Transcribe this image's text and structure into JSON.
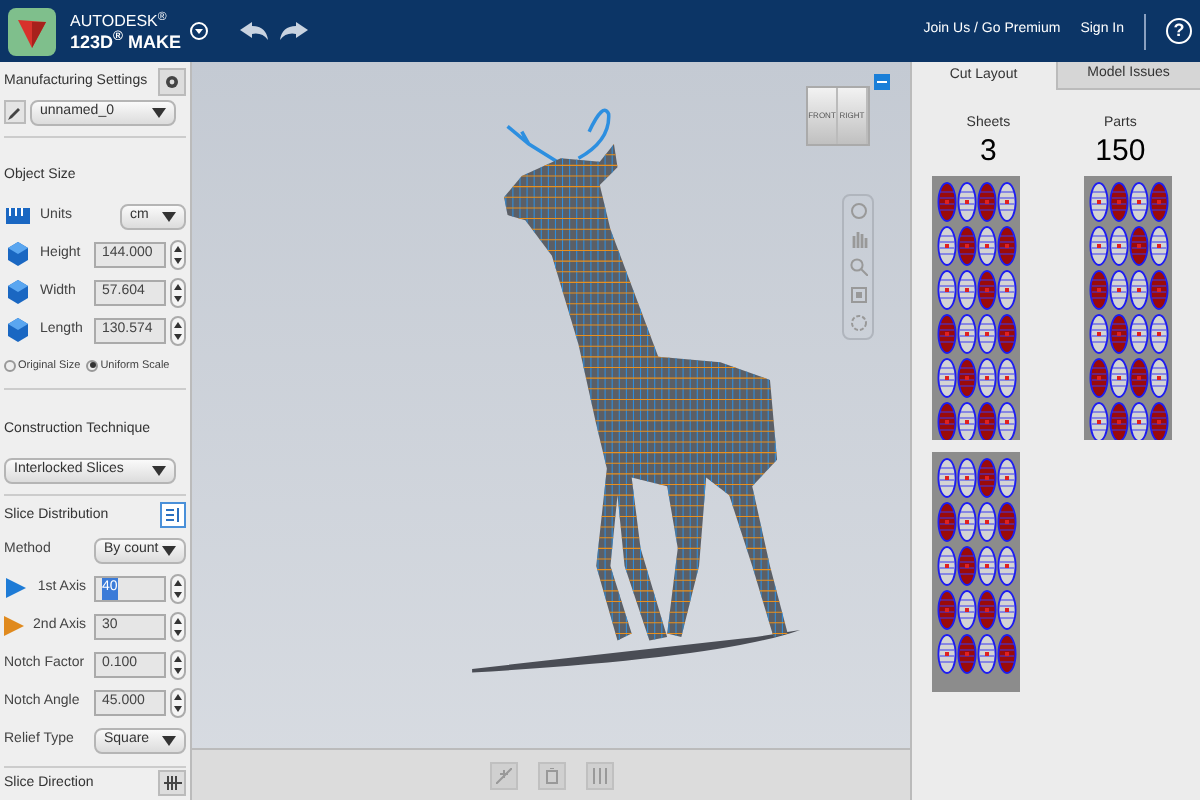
{
  "header": {
    "brand": "AUTODESK$^{®}$",
    "product": "123D$^{®}$ MAKE",
    "links": [
      "Join Us / Go Premium",
      "Sign In"
    ],
    "help": "?"
  },
  "manufacturing_settings": {
    "title": "Manufacturing Settings",
    "profile": "unnamed_0"
  },
  "object_size": {
    "title": "Object Size",
    "fields": [
      {
        "kind": "select",
        "label": "Units",
        "value": "cm"
      },
      {
        "kind": "number",
        "label": "Height",
        "value": "144.000"
      },
      {
        "kind": "number",
        "label": "Width",
        "value": "57.604"
      },
      {
        "kind": "number",
        "label": "Length",
        "value": "130.574"
      }
    ],
    "scale_options": [
      {
        "label": "Original Size",
        "selected": false
      },
      {
        "label": "Uniform Scale",
        "selected": true
      }
    ]
  },
  "construction_technique": {
    "title": "Construction Technique",
    "value": "Interlocked Slices"
  },
  "slice_distribution": {
    "title": "Slice Distribution",
    "fields": [
      {
        "kind": "select",
        "label": "Method",
        "value": "By count"
      },
      {
        "kind": "axis",
        "label": "1st Axis",
        "value": "40",
        "color": "#1e7bd6",
        "highlighted": true
      },
      {
        "kind": "axis",
        "label": "2nd Axis",
        "value": "30",
        "color": "#e08a1e",
        "highlighted": false
      },
      {
        "kind": "number",
        "label": "Notch Factor",
        "value": "0.100"
      },
      {
        "kind": "number",
        "label": "Notch Angle",
        "value": "45.000"
      },
      {
        "kind": "select",
        "label": "Relief Type",
        "value": "Square"
      }
    ]
  },
  "slice_direction": {
    "title": "Slice Direction"
  },
  "view_cube": {
    "faces": [
      "FRONT",
      "RIGHT"
    ]
  },
  "tabs": [
    {
      "label": "Cut Layout",
      "selected": true
    },
    {
      "label": "Model Issues",
      "selected": false
    }
  ],
  "stats": [
    {
      "label": "Sheets",
      "value": "3"
    },
    {
      "label": "Parts",
      "value": "150"
    }
  ]
}
